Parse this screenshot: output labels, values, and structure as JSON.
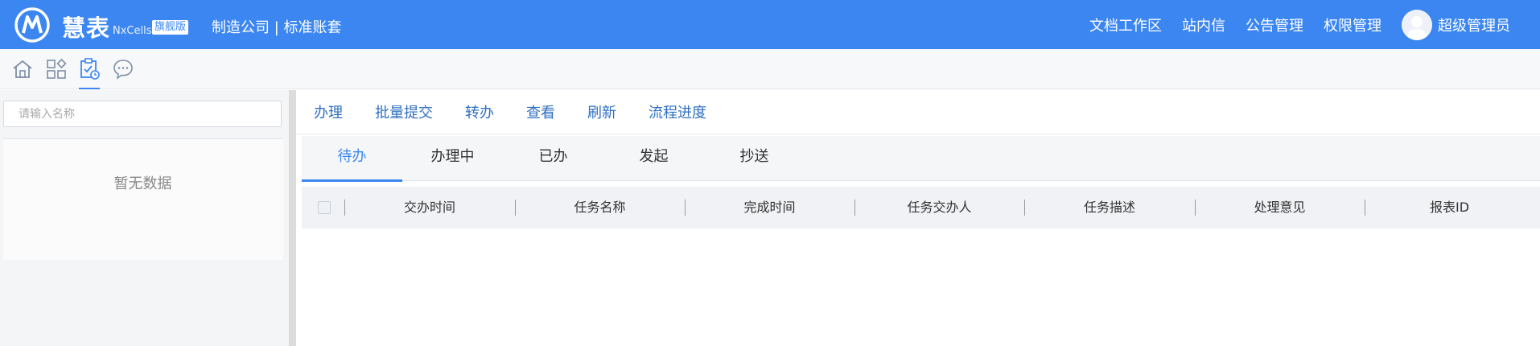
{
  "header": {
    "brand": "慧表",
    "brand_en": "NxCells",
    "edition_badge": "旗舰版",
    "company": "制造公司 | 标准账套",
    "nav": [
      "文档工作区",
      "站内信",
      "公告管理",
      "权限管理"
    ],
    "user": "超级管理员",
    "color": "#3b86f1"
  },
  "iconbar": {
    "icons": [
      "home-icon",
      "apps-icon",
      "task-clipboard-icon",
      "message-icon"
    ],
    "active_index": 2
  },
  "left_panel": {
    "search_placeholder": "请输入名称",
    "empty_text": "暂无数据"
  },
  "main": {
    "actions": [
      "办理",
      "批量提交",
      "转办",
      "查看",
      "刷新",
      "流程进度"
    ],
    "tabs": [
      "待办",
      "办理中",
      "已办",
      "发起",
      "抄送"
    ],
    "active_tab": 0,
    "columns": [
      "交办时间",
      "任务名称",
      "完成时间",
      "任务交办人",
      "任务描述",
      "处理意见",
      "报表ID"
    ]
  }
}
